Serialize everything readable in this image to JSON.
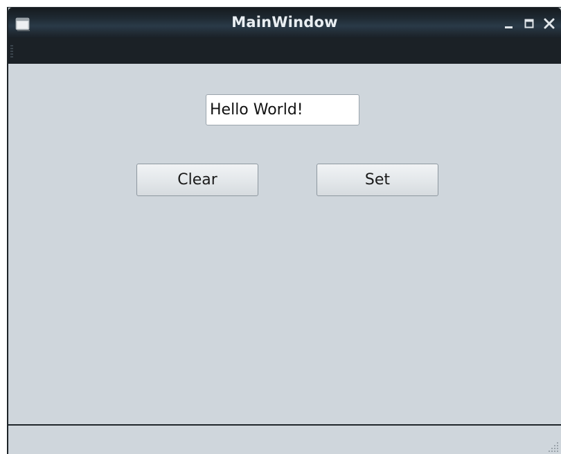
{
  "window": {
    "title": "MainWindow"
  },
  "titlebar": {
    "app_icon": "window-icon",
    "controls": [
      "minimize-icon",
      "maximize-icon",
      "close-icon"
    ]
  },
  "central": {
    "line_edit": {
      "value": "Hello World!"
    },
    "buttons": {
      "clear_label": "Clear",
      "set_label": "Set"
    }
  },
  "statusbar": {
    "size_grip": "size-grip-icon"
  },
  "colors": {
    "window_background": "#cfd6dc",
    "titlebar": "#1f2a33",
    "title_text": "#e9eef2",
    "menubar": "#1b2126"
  }
}
